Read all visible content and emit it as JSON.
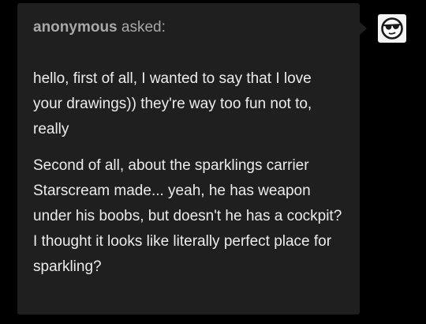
{
  "ask": {
    "author": "anonymous",
    "verb": "asked:",
    "paragraphs": [
      "hello, first of all, I wanted to say that I love your drawings)) they're way too fun not to, really",
      "Second of all, about the sparklings carrier Starscream made... yeah, he has weapon under his boobs, but doesn't he has a cockpit? I thought it looks like literally perfect place for sparkling?"
    ]
  },
  "avatar": {
    "icon": "anonymous-sunglasses-icon"
  },
  "colors": {
    "page_background": "#000000",
    "card_background": "#1f1f1f",
    "header_text": "#a8a8a8",
    "body_text": "#ececec",
    "avatar_background": "#f4f4f4"
  }
}
